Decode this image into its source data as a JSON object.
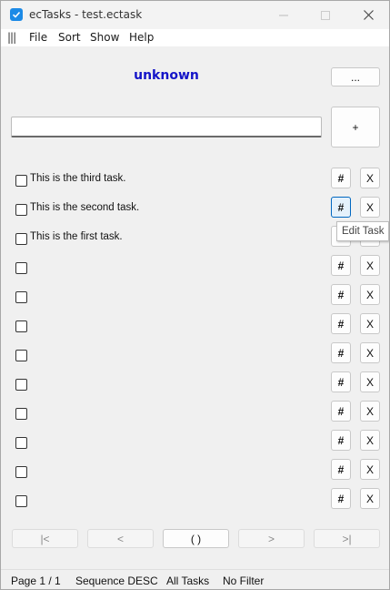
{
  "window": {
    "title": "ecTasks - test.ectask"
  },
  "menu": {
    "grip": "|||",
    "file": "File",
    "sort": "Sort",
    "show": "Show",
    "help": "Help"
  },
  "header": {
    "project": "unknown",
    "more_label": "...",
    "add_label": "+",
    "input_value": ""
  },
  "tasks": [
    {
      "text": "This is the third task.",
      "checked": false
    },
    {
      "text": "This is the second task.",
      "checked": false
    },
    {
      "text": "This is the first task.",
      "checked": false
    },
    {
      "text": "",
      "checked": false
    },
    {
      "text": "",
      "checked": false
    },
    {
      "text": "",
      "checked": false
    },
    {
      "text": "",
      "checked": false
    },
    {
      "text": "",
      "checked": false
    },
    {
      "text": "",
      "checked": false
    },
    {
      "text": "",
      "checked": false
    },
    {
      "text": "",
      "checked": false
    },
    {
      "text": "",
      "checked": false
    }
  ],
  "row_buttons": {
    "edit": "#",
    "delete": "X"
  },
  "tooltip": "Edit Task",
  "pager": {
    "first": "|<",
    "prev": "<",
    "current": "(  )",
    "next": ">",
    "last": ">|"
  },
  "status": {
    "page": "Page 1 / 1",
    "sequence": "Sequence DESC",
    "tasks": "All Tasks",
    "filter": "No Filter"
  },
  "colors": {
    "project": "#1414c8",
    "accent": "#0067c0"
  }
}
